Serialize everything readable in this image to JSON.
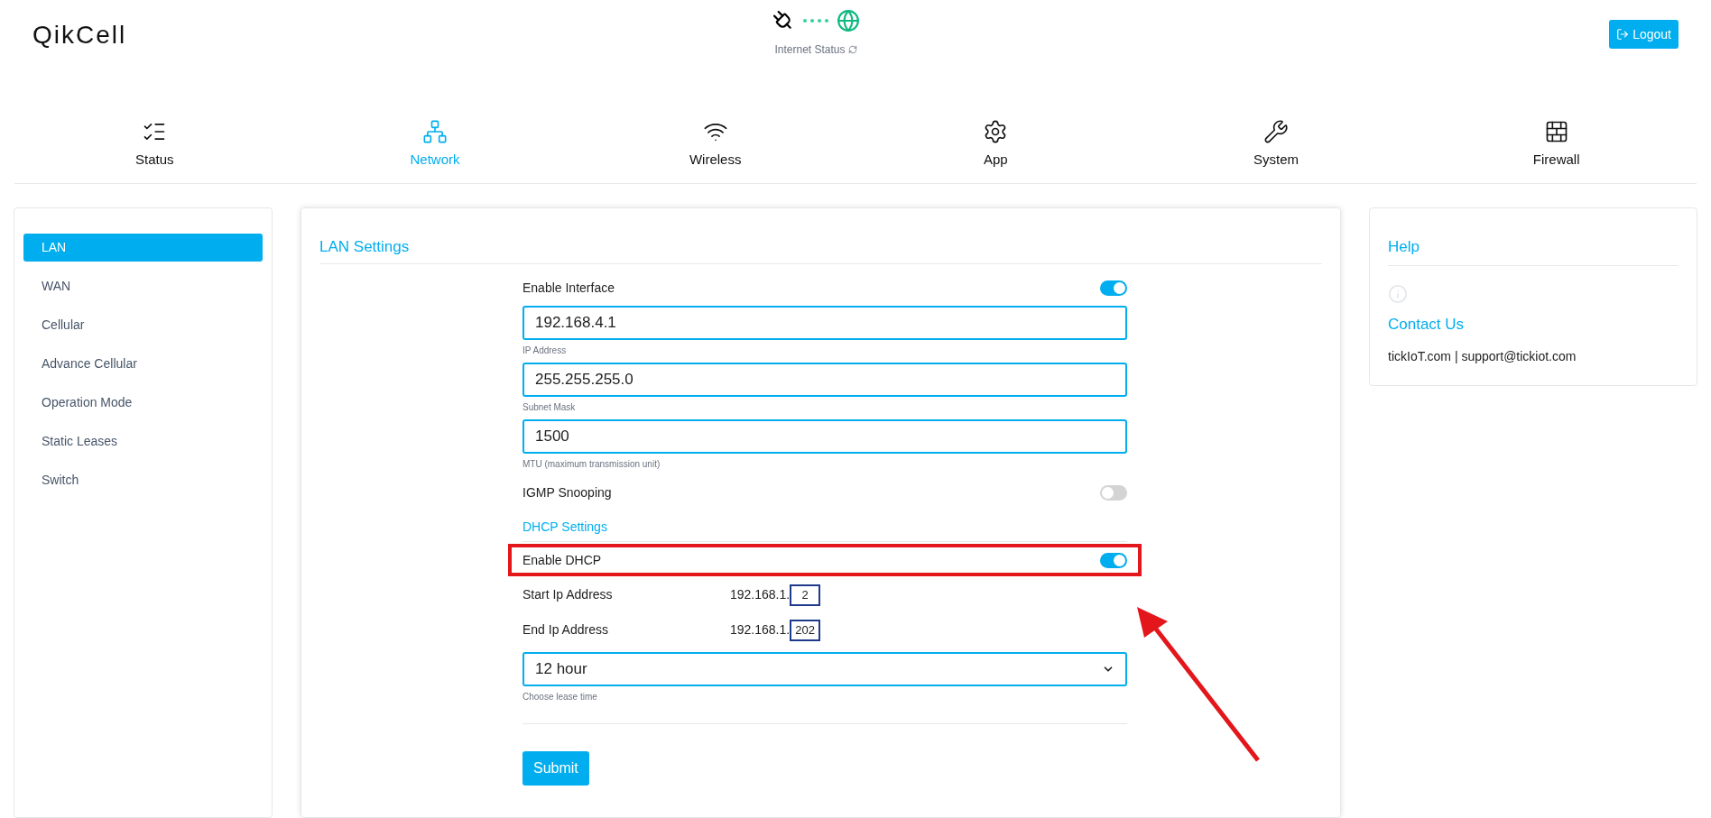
{
  "header": {
    "logo": "QikCell",
    "internet_status": "Internet Status",
    "logout": "Logout"
  },
  "nav": [
    {
      "kind": "status",
      "label": "Status",
      "selected": false
    },
    {
      "kind": "network",
      "label": "Network",
      "selected": true
    },
    {
      "kind": "wireless",
      "label": "Wireless",
      "selected": false
    },
    {
      "kind": "app",
      "label": "App",
      "selected": false
    },
    {
      "kind": "system",
      "label": "System",
      "selected": false
    },
    {
      "kind": "firewall",
      "label": "Firewall",
      "selected": false
    }
  ],
  "sidebar": [
    {
      "label": "LAN",
      "selected": true
    },
    {
      "label": "WAN",
      "selected": false
    },
    {
      "label": "Cellular",
      "selected": false
    },
    {
      "label": "Advance Cellular",
      "selected": false
    },
    {
      "label": "Operation Mode",
      "selected": false
    },
    {
      "label": "Static Leases",
      "selected": false
    },
    {
      "label": "Switch",
      "selected": false
    }
  ],
  "main": {
    "title": "LAN Settings",
    "fields": [
      {
        "kind": "toggle",
        "label": "Enable Interface",
        "on": true,
        "highlighted": false
      },
      {
        "kind": "input",
        "value": "192.168.4.1",
        "caption": "IP Address"
      },
      {
        "kind": "input",
        "value": "255.255.255.0",
        "caption": "Subnet Mask"
      },
      {
        "kind": "input",
        "value": "1500",
        "caption": "MTU (maximum transmission unit)"
      },
      {
        "kind": "toggle",
        "label": "IGMP Snooping",
        "on": false,
        "highlighted": false
      },
      {
        "kind": "section",
        "label": "DHCP Settings"
      },
      {
        "kind": "toggle",
        "label": "Enable DHCP",
        "on": true,
        "highlighted": true
      },
      {
        "kind": "range",
        "label": "Start Ip Address",
        "prefix": "192.168.1.",
        "value": "2"
      },
      {
        "kind": "range",
        "label": "End Ip Address",
        "prefix": "192.168.1.",
        "value": "202"
      },
      {
        "kind": "select",
        "value": "12 hour",
        "caption": "Choose lease time"
      }
    ],
    "submit": "Submit"
  },
  "help": {
    "title": "Help",
    "contact_title": "Contact Us",
    "contact": "tickIoT.com | support@tickiot.com"
  }
}
